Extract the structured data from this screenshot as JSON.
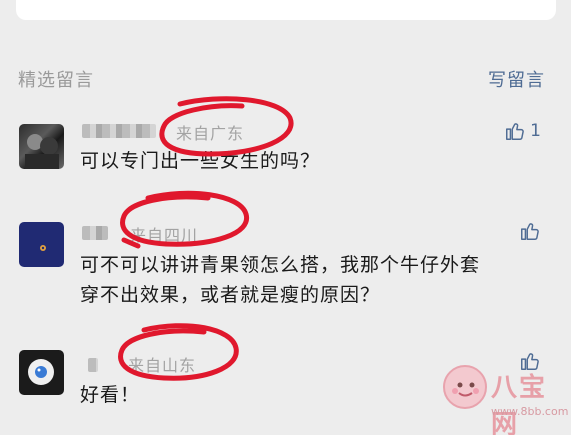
{
  "section": {
    "title": "精选留言",
    "write_comment": "写留言"
  },
  "comments": [
    {
      "origin": "来自广东",
      "text": "可以专门出一些女生的吗？",
      "likes": "1"
    },
    {
      "origin": "来自四川",
      "text_line1": "可不可以讲讲青果领怎么搭，我那个牛仔外套",
      "text_line2": "穿不出效果，或者就是瘦的原因？",
      "likes": ""
    },
    {
      "origin": "来自山东",
      "text": "好看！",
      "likes": ""
    }
  ],
  "watermark": {
    "title": "八宝网",
    "url": "www.8bb.com"
  },
  "colors": {
    "background": "#ededed",
    "link_blue": "#4f6c94",
    "annotation_red": "#e0182d"
  }
}
